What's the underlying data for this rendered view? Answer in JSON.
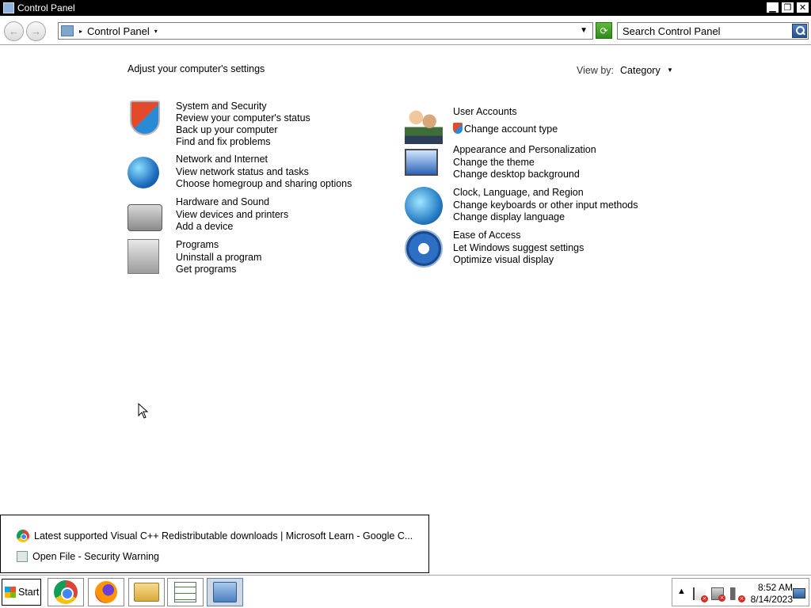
{
  "window": {
    "title": "Control Panel",
    "minimize_glyph": "▁",
    "restore_glyph": "❐",
    "close_glyph": "✕"
  },
  "toolbar": {
    "back_glyph": "←",
    "forward_glyph": "→",
    "address_separator": "▸",
    "breadcrumb": "Control Panel",
    "breadcrumb_arrow": "▾",
    "dropdown_glyph": "▼",
    "refresh_glyph": "⟳",
    "search_placeholder": "Search Control Panel"
  },
  "content": {
    "heading": "Adjust your computer's settings",
    "view_by_label": "View by:",
    "view_by_value": "Category",
    "view_by_caret": "▼"
  },
  "categories_left": [
    {
      "icon": "security-shield-icon",
      "title": "System and Security",
      "links": [
        "Review your computer's status",
        "Back up your computer",
        "Find and fix problems"
      ]
    },
    {
      "icon": "network-globe-icon",
      "title": "Network and Internet",
      "links": [
        "View network status and tasks",
        "Choose homegroup and sharing options"
      ]
    },
    {
      "icon": "printer-icon",
      "title": "Hardware and Sound",
      "links": [
        "View devices and printers",
        "Add a device"
      ]
    },
    {
      "icon": "programs-icon",
      "title": "Programs",
      "links": [
        "Uninstall a program",
        "Get programs"
      ]
    }
  ],
  "categories_right": [
    {
      "icon": "users-icon",
      "title": "User Accounts",
      "links": [
        "Change account type"
      ]
    },
    {
      "icon": "appearance-icon",
      "title": "Appearance and Personalization",
      "links": [
        "Change the theme",
        "Change desktop background"
      ]
    },
    {
      "icon": "clock-globe-icon",
      "title": "Clock, Language, and Region",
      "links": [
        "Change keyboards or other input methods",
        "Change display language"
      ]
    },
    {
      "icon": "ease-of-access-icon",
      "title": "Ease of Access",
      "links": [
        "Let Windows suggest settings",
        "Optimize visual display"
      ]
    }
  ],
  "jumplist": {
    "items": [
      "Latest supported Visual C++ Redistributable downloads | Microsoft Learn - Google C...",
      "Open File - Security Warning"
    ]
  },
  "taskbar": {
    "start_label": "Start",
    "buttons": [
      "chrome-icon",
      "firefox-icon",
      "file-explorer-icon",
      "task-list-icon",
      "control-panel-icon"
    ],
    "active_button": "control-panel-icon",
    "tray_chevron": "▲",
    "time": "8:52 AM",
    "date": "8/14/2023",
    "badge_glyph": "×"
  }
}
